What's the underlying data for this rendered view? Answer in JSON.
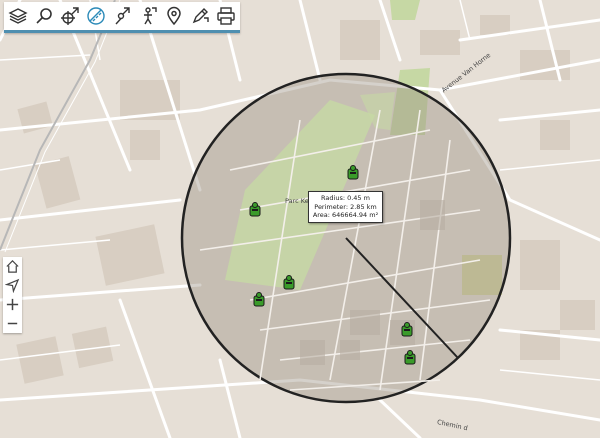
{
  "toolbar": {
    "tools": [
      {
        "name": "layers",
        "icon": "layers-icon"
      },
      {
        "name": "search",
        "icon": "search-icon"
      },
      {
        "name": "locate",
        "icon": "crosshair-pin-icon"
      },
      {
        "name": "measure",
        "icon": "measure-ruler-icon",
        "active": true
      },
      {
        "name": "draw",
        "icon": "pin-pencil-icon"
      },
      {
        "name": "poi",
        "icon": "person-pin-icon"
      },
      {
        "name": "marker",
        "icon": "map-marker-icon"
      },
      {
        "name": "edit",
        "icon": "edit-pen-icon"
      },
      {
        "name": "print",
        "icon": "printer-icon"
      }
    ],
    "accent": "#4f8fb0"
  },
  "map_controls": [
    {
      "name": "home",
      "icon": "home-icon"
    },
    {
      "name": "locate-me",
      "icon": "navigation-arrow-icon"
    },
    {
      "name": "zoom-in",
      "icon": "plus-icon"
    },
    {
      "name": "zoom-out",
      "icon": "minus-icon"
    }
  ],
  "measurement": {
    "radius": "Radius: 0.45 m",
    "perimeter": "Perimeter: 2.85 km",
    "area": "Area: 646664.94 m²"
  },
  "labels": {
    "park": "Parc Ke",
    "street_top": "Avenue Van Horne",
    "street_bottom": "Chemin d"
  },
  "colors": {
    "land": "#e6dfd6",
    "park": "#c6d8a4",
    "building": "#d6ccc0",
    "road": "#ffffff",
    "circle_fill": "#9c9184",
    "marker": "#3a9b2a"
  }
}
